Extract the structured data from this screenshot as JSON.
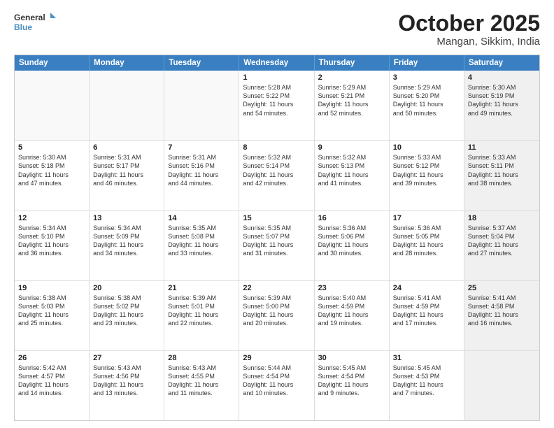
{
  "logo": {
    "line1": "General",
    "line2": "Blue"
  },
  "title": "October 2025",
  "location": "Mangan, Sikkim, India",
  "days_of_week": [
    "Sunday",
    "Monday",
    "Tuesday",
    "Wednesday",
    "Thursday",
    "Friday",
    "Saturday"
  ],
  "weeks": [
    [
      {
        "day": "",
        "text": "",
        "empty": true
      },
      {
        "day": "",
        "text": "",
        "empty": true
      },
      {
        "day": "",
        "text": "",
        "empty": true
      },
      {
        "day": "1",
        "text": "Sunrise: 5:28 AM\nSunset: 5:22 PM\nDaylight: 11 hours\nand 54 minutes.",
        "empty": false
      },
      {
        "day": "2",
        "text": "Sunrise: 5:29 AM\nSunset: 5:21 PM\nDaylight: 11 hours\nand 52 minutes.",
        "empty": false
      },
      {
        "day": "3",
        "text": "Sunrise: 5:29 AM\nSunset: 5:20 PM\nDaylight: 11 hours\nand 50 minutes.",
        "empty": false
      },
      {
        "day": "4",
        "text": "Sunrise: 5:30 AM\nSunset: 5:19 PM\nDaylight: 11 hours\nand 49 minutes.",
        "empty": false,
        "shaded": true
      }
    ],
    [
      {
        "day": "5",
        "text": "Sunrise: 5:30 AM\nSunset: 5:18 PM\nDaylight: 11 hours\nand 47 minutes.",
        "empty": false
      },
      {
        "day": "6",
        "text": "Sunrise: 5:31 AM\nSunset: 5:17 PM\nDaylight: 11 hours\nand 46 minutes.",
        "empty": false
      },
      {
        "day": "7",
        "text": "Sunrise: 5:31 AM\nSunset: 5:16 PM\nDaylight: 11 hours\nand 44 minutes.",
        "empty": false
      },
      {
        "day": "8",
        "text": "Sunrise: 5:32 AM\nSunset: 5:14 PM\nDaylight: 11 hours\nand 42 minutes.",
        "empty": false
      },
      {
        "day": "9",
        "text": "Sunrise: 5:32 AM\nSunset: 5:13 PM\nDaylight: 11 hours\nand 41 minutes.",
        "empty": false
      },
      {
        "day": "10",
        "text": "Sunrise: 5:33 AM\nSunset: 5:12 PM\nDaylight: 11 hours\nand 39 minutes.",
        "empty": false
      },
      {
        "day": "11",
        "text": "Sunrise: 5:33 AM\nSunset: 5:11 PM\nDaylight: 11 hours\nand 38 minutes.",
        "empty": false,
        "shaded": true
      }
    ],
    [
      {
        "day": "12",
        "text": "Sunrise: 5:34 AM\nSunset: 5:10 PM\nDaylight: 11 hours\nand 36 minutes.",
        "empty": false
      },
      {
        "day": "13",
        "text": "Sunrise: 5:34 AM\nSunset: 5:09 PM\nDaylight: 11 hours\nand 34 minutes.",
        "empty": false
      },
      {
        "day": "14",
        "text": "Sunrise: 5:35 AM\nSunset: 5:08 PM\nDaylight: 11 hours\nand 33 minutes.",
        "empty": false
      },
      {
        "day": "15",
        "text": "Sunrise: 5:35 AM\nSunset: 5:07 PM\nDaylight: 11 hours\nand 31 minutes.",
        "empty": false
      },
      {
        "day": "16",
        "text": "Sunrise: 5:36 AM\nSunset: 5:06 PM\nDaylight: 11 hours\nand 30 minutes.",
        "empty": false
      },
      {
        "day": "17",
        "text": "Sunrise: 5:36 AM\nSunset: 5:05 PM\nDaylight: 11 hours\nand 28 minutes.",
        "empty": false
      },
      {
        "day": "18",
        "text": "Sunrise: 5:37 AM\nSunset: 5:04 PM\nDaylight: 11 hours\nand 27 minutes.",
        "empty": false,
        "shaded": true
      }
    ],
    [
      {
        "day": "19",
        "text": "Sunrise: 5:38 AM\nSunset: 5:03 PM\nDaylight: 11 hours\nand 25 minutes.",
        "empty": false
      },
      {
        "day": "20",
        "text": "Sunrise: 5:38 AM\nSunset: 5:02 PM\nDaylight: 11 hours\nand 23 minutes.",
        "empty": false
      },
      {
        "day": "21",
        "text": "Sunrise: 5:39 AM\nSunset: 5:01 PM\nDaylight: 11 hours\nand 22 minutes.",
        "empty": false
      },
      {
        "day": "22",
        "text": "Sunrise: 5:39 AM\nSunset: 5:00 PM\nDaylight: 11 hours\nand 20 minutes.",
        "empty": false
      },
      {
        "day": "23",
        "text": "Sunrise: 5:40 AM\nSunset: 4:59 PM\nDaylight: 11 hours\nand 19 minutes.",
        "empty": false
      },
      {
        "day": "24",
        "text": "Sunrise: 5:41 AM\nSunset: 4:59 PM\nDaylight: 11 hours\nand 17 minutes.",
        "empty": false
      },
      {
        "day": "25",
        "text": "Sunrise: 5:41 AM\nSunset: 4:58 PM\nDaylight: 11 hours\nand 16 minutes.",
        "empty": false,
        "shaded": true
      }
    ],
    [
      {
        "day": "26",
        "text": "Sunrise: 5:42 AM\nSunset: 4:57 PM\nDaylight: 11 hours\nand 14 minutes.",
        "empty": false
      },
      {
        "day": "27",
        "text": "Sunrise: 5:43 AM\nSunset: 4:56 PM\nDaylight: 11 hours\nand 13 minutes.",
        "empty": false
      },
      {
        "day": "28",
        "text": "Sunrise: 5:43 AM\nSunset: 4:55 PM\nDaylight: 11 hours\nand 11 minutes.",
        "empty": false
      },
      {
        "day": "29",
        "text": "Sunrise: 5:44 AM\nSunset: 4:54 PM\nDaylight: 11 hours\nand 10 minutes.",
        "empty": false
      },
      {
        "day": "30",
        "text": "Sunrise: 5:45 AM\nSunset: 4:54 PM\nDaylight: 11 hours\nand 9 minutes.",
        "empty": false
      },
      {
        "day": "31",
        "text": "Sunrise: 5:45 AM\nSunset: 4:53 PM\nDaylight: 11 hours\nand 7 minutes.",
        "empty": false
      },
      {
        "day": "",
        "text": "",
        "empty": true,
        "shaded": true
      }
    ]
  ]
}
